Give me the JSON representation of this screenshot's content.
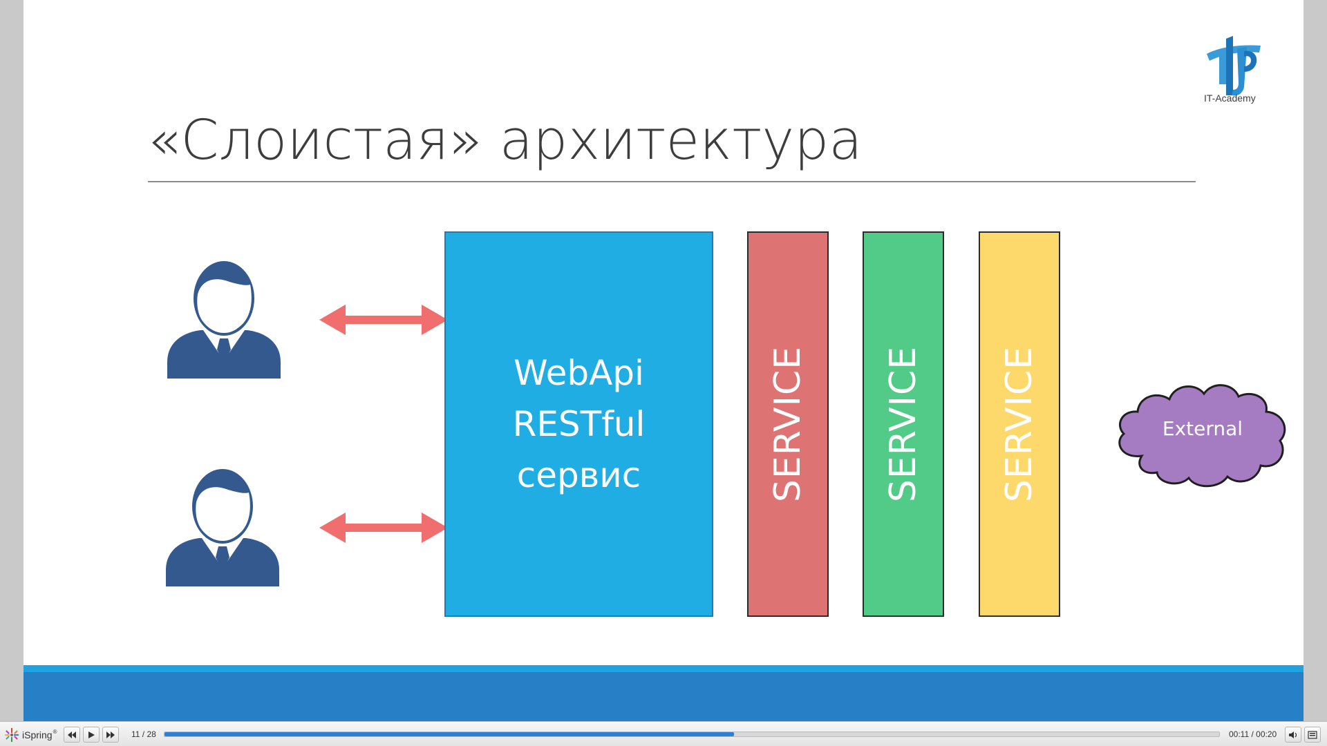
{
  "slide": {
    "title": "«Слоистая» архитектура",
    "logo": {
      "text": "IT-Academy"
    },
    "webapi": {
      "lines": [
        "WebApi",
        "RESTful",
        "сервис"
      ]
    },
    "services": [
      {
        "label": "SERVICE",
        "color": "#de7373"
      },
      {
        "label": "SERVICE",
        "color": "#51cb87"
      },
      {
        "label": "SERVICE",
        "color": "#fdd96b"
      }
    ],
    "external": {
      "label": "External",
      "color": "#a57cc2"
    },
    "colors": {
      "accent_blue": "#1fade3",
      "arrow": "#f16e6e",
      "user": "#34598f",
      "band_light": "#1fa3e0",
      "band_dark": "#2780c5"
    },
    "icons": [
      "user-icon",
      "double-arrow-icon",
      "cloud-icon"
    ]
  },
  "player": {
    "brand": "iSpring",
    "brand_mark": "®",
    "slide_counter": "11 / 28",
    "progress_fraction": 0.54,
    "time": "00:11 / 00:20",
    "buttons": [
      "previous-button",
      "play-button",
      "next-button",
      "volume-button",
      "outline-button"
    ]
  }
}
